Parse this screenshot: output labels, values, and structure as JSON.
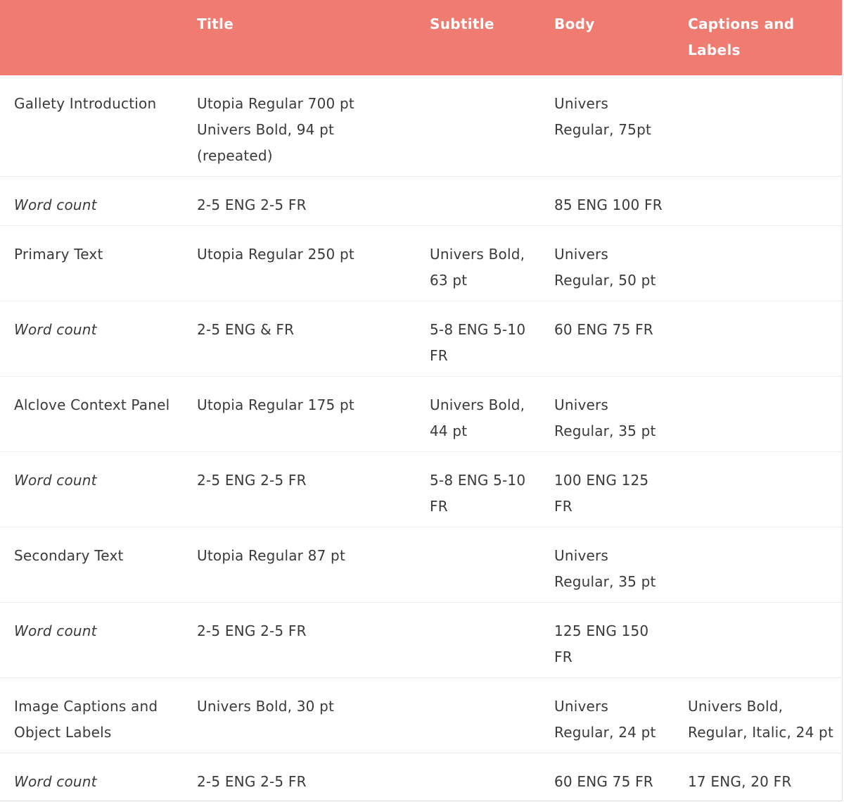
{
  "header": {
    "row_label": "",
    "title": "Title",
    "subtitle": "Subtitle",
    "body": "Body",
    "captions": "Captions and Labels"
  },
  "rows": [
    {
      "label": "Gallety Introduction",
      "title": [
        "Utopia Regular 700 pt",
        "Univers Bold, 94 pt",
        "(repeated)"
      ],
      "subtitle": "",
      "body": "Univers Regular, 75pt",
      "captions": ""
    },
    {
      "label": "Word count",
      "title": [
        "2-5 ENG 2-5 FR"
      ],
      "subtitle": "",
      "body": "85 ENG 100 FR",
      "captions": ""
    },
    {
      "label": "Primary Text",
      "title": [
        "Utopia Regular 250 pt"
      ],
      "subtitle": "Univers Bold, 63 pt",
      "body": "Univers Regular, 50 pt",
      "captions": ""
    },
    {
      "label": "Word count",
      "title": [
        "2-5 ENG & FR"
      ],
      "subtitle": "5-8 ENG 5-10 FR",
      "body": "60 ENG 75 FR",
      "captions": ""
    },
    {
      "label": "Alclove Context Panel",
      "title": [
        "Utopia Regular 175 pt"
      ],
      "subtitle": "Univers Bold, 44 pt",
      "body": "Univers Regular, 35 pt",
      "captions": ""
    },
    {
      "label": "Word count",
      "title": [
        "2-5 ENG 2-5 FR"
      ],
      "subtitle": "5-8 ENG 5-10 FR",
      "body": "100 ENG 125 FR",
      "captions": ""
    },
    {
      "label": "Secondary Text",
      "title": [
        "Utopia Regular 87 pt"
      ],
      "subtitle": "",
      "body": "Univers Regular, 35 pt",
      "captions": ""
    },
    {
      "label": "Word count",
      "title": [
        "2-5 ENG 2-5 FR"
      ],
      "subtitle": "",
      "body": "125 ENG 150 FR",
      "captions": ""
    },
    {
      "label": "Image Captions and Object Labels",
      "title": [
        "Univers Bold, 30 pt"
      ],
      "subtitle": "",
      "body": "Univers Regular, 24 pt",
      "captions": "Univers Bold, Regular, Italic, 24 pt"
    },
    {
      "label": "Word count",
      "title": [
        "2-5 ENG 2-5 FR"
      ],
      "subtitle": "",
      "body": "60 ENG 75 FR",
      "captions": "17 ENG, 20 FR"
    }
  ]
}
